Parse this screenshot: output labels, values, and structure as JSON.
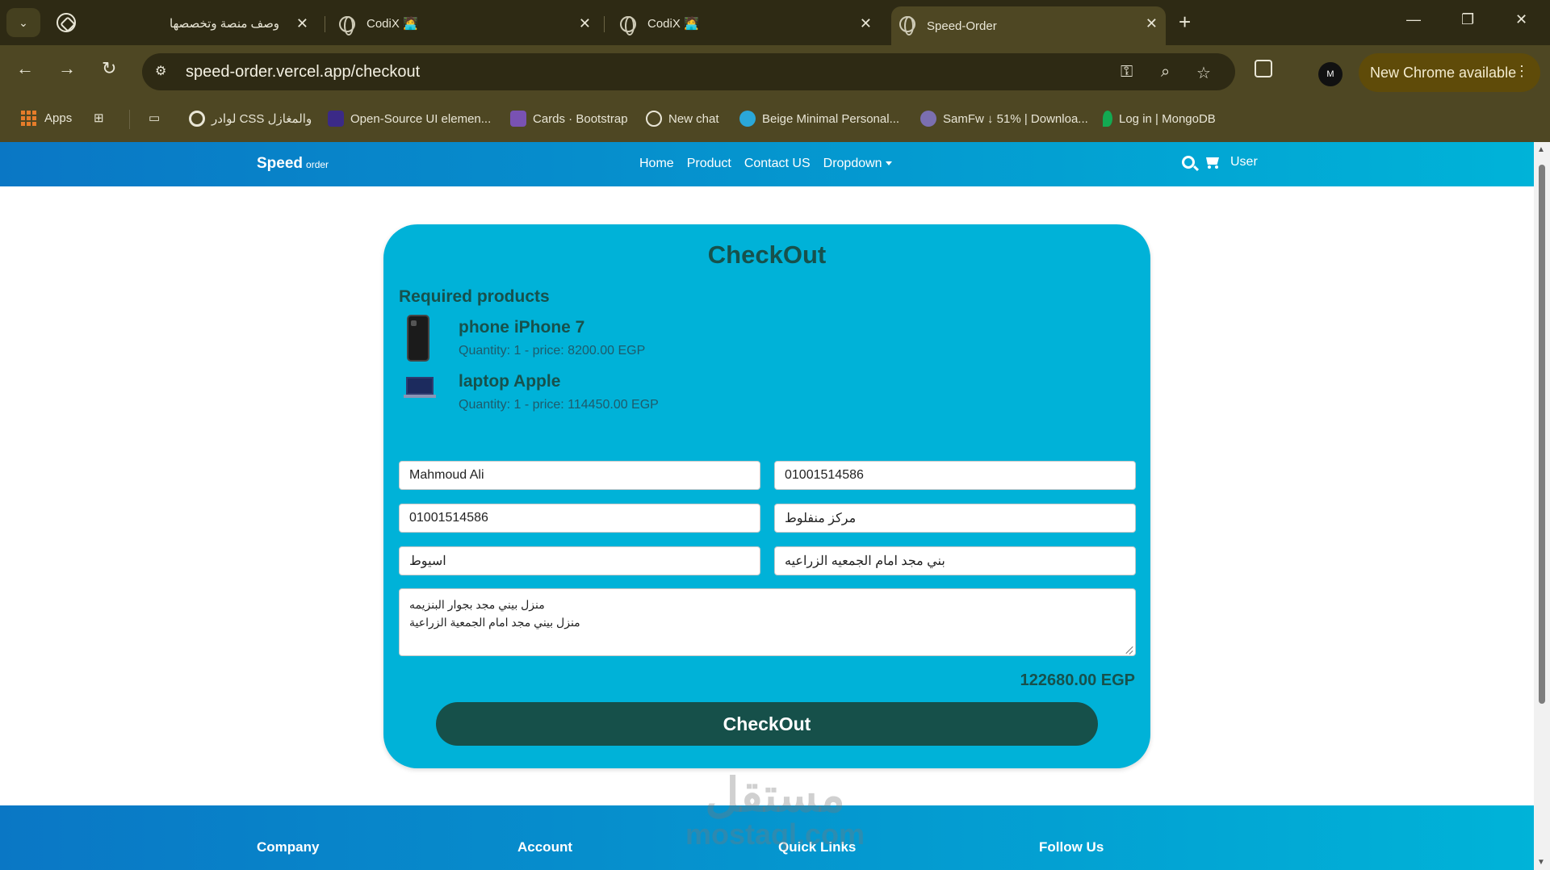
{
  "browser": {
    "tabs": [
      {
        "title": "وصف منصة وتخصصها",
        "active": false
      },
      {
        "title": "CodiX 🧑‍💻",
        "active": false
      },
      {
        "title": "CodiX 🧑‍💻",
        "active": false
      },
      {
        "title": "Speed-Order",
        "active": true
      }
    ],
    "address": "speed-order.vercel.app/checkout",
    "update_label": "New Chrome available",
    "profile_initials": "M",
    "bookmarks": [
      {
        "label": "Apps",
        "icon": "apps-grid-icon"
      },
      {
        "label": "لوادر CSS والمغازل",
        "icon": "loader-icon"
      },
      {
        "label": "Open-Source UI elemen...",
        "icon": "uiverse-icon"
      },
      {
        "label": "Cards · Bootstrap",
        "icon": "bootstrap-icon"
      },
      {
        "label": "New chat",
        "icon": "openai-icon"
      },
      {
        "label": "Beige Minimal Personal...",
        "icon": "canva-icon"
      },
      {
        "label": "SamFw ↓ 51% | Downloa...",
        "icon": "samfw-icon"
      },
      {
        "label": "Log in | MongoDB",
        "icon": "mongodb-leaf-icon"
      }
    ],
    "colors": {
      "frame": "#2e2a14",
      "toolbar": "#4e4723",
      "update_pill": "#5f4b09"
    }
  },
  "site": {
    "brand": "Speed",
    "brand_suffix": "order",
    "nav": [
      "Home",
      "Product",
      "Contact US",
      "Dropdown"
    ],
    "user_label": "User",
    "colors": {
      "nav_gradient_start": "#0a77c5",
      "nav_gradient_end": "#00b3d8",
      "card": "#00b2d8",
      "dark_teal": "#16504a"
    }
  },
  "checkout": {
    "title": "CheckOut",
    "required_title": "Required products",
    "products": [
      {
        "name": "phone iPhone 7",
        "meta": "Quantity: 1 - price: 8200.00 EGP",
        "image": "phone-image"
      },
      {
        "name": "laptop Apple",
        "meta": "Quantity: 1 - price: 114450.00 EGP",
        "image": "laptop-image"
      }
    ],
    "fields": {
      "name": "Mahmoud Ali",
      "phone": "01001514586",
      "phone2": "01001514586",
      "center": "مركز منفلوط",
      "governorate": "اسيوط",
      "village": "بني مجد امام الجمعيه الزراعيه",
      "address_line1": "منزل بيني مجد بجوار البنزيمه",
      "address_line2": "منزل بيني مجد امام الجمعية الزراعية"
    },
    "total": "122680.00 EGP",
    "button_label": "CheckOut"
  },
  "footer": {
    "columns": [
      "Company",
      "Account",
      "Quick Links",
      "Follow Us"
    ]
  },
  "watermark": {
    "arabic": "مستقل",
    "latin": "mostaql.com"
  }
}
